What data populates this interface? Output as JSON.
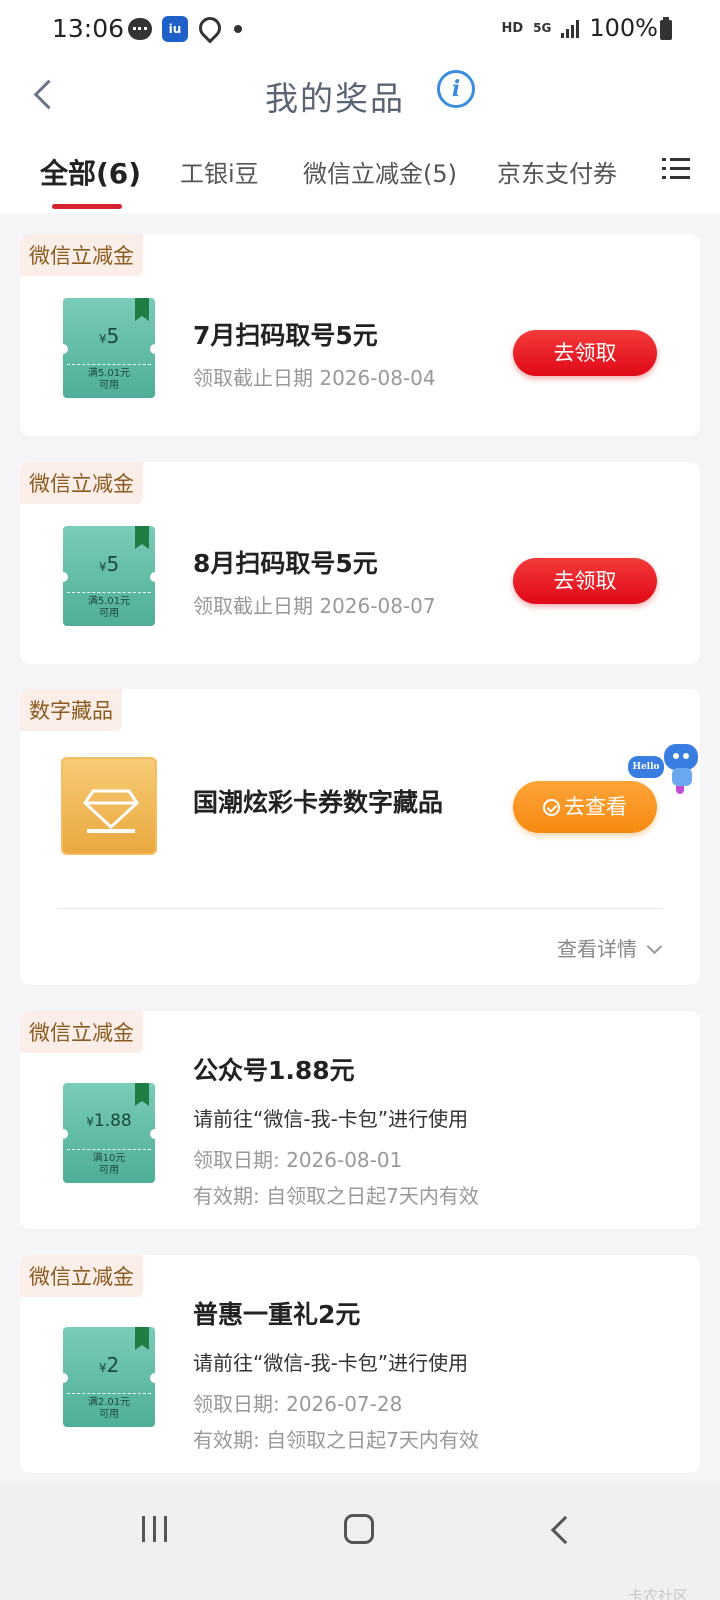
{
  "status_bar": {
    "time": "13:06",
    "app_icon_text": "iu",
    "hd": "HD",
    "network": "5G",
    "battery": "100%"
  },
  "header": {
    "title": "我的奖品",
    "info_icon": "i"
  },
  "tabs": [
    {
      "label": "全部(6)",
      "active": true
    },
    {
      "label": "工银i豆",
      "active": false
    },
    {
      "label": "微信立减金(5)",
      "active": false
    },
    {
      "label": "京东支付券",
      "active": false
    }
  ],
  "cards": [
    {
      "tag": "微信立减金",
      "coupon": {
        "symbol": "¥",
        "amount": "5",
        "cond_line1": "满5.01元",
        "cond_line2": "可用"
      },
      "title": "7月扫码取号5元",
      "subtitle": "领取截止日期 2026-08-04",
      "button": "去领取"
    },
    {
      "tag": "微信立减金",
      "coupon": {
        "symbol": "¥",
        "amount": "5",
        "cond_line1": "满5.01元",
        "cond_line2": "可用"
      },
      "title": "8月扫码取号5元",
      "subtitle": "领取截止日期 2026-08-07",
      "button": "去领取"
    },
    {
      "tag": "数字藏品",
      "title": "国潮炫彩卡券数字藏品",
      "button": "去查看",
      "details_link": "查看详情"
    },
    {
      "tag": "微信立减金",
      "coupon": {
        "symbol": "¥",
        "amount": "1.88",
        "cond_line1": "满10元",
        "cond_line2": "可用"
      },
      "title": "公众号1.88元",
      "desc": "请前往“微信-我-卡包”进行使用",
      "date": "领取日期: 2026-08-01",
      "validity": "有效期: 自领取之日起7天内有效"
    },
    {
      "tag": "微信立减金",
      "coupon": {
        "symbol": "¥",
        "amount": "2",
        "cond_line1": "满2.01元",
        "cond_line2": "可用"
      },
      "title": "普惠一重礼2元",
      "desc": "请前往“微信-我-卡包”进行使用",
      "date": "领取日期: 2026-07-28",
      "validity": "有效期: 自领取之日起7天内有效"
    }
  ],
  "assistant": {
    "bubble": "Hello"
  },
  "watermark": "卡农社区",
  "colors": {
    "accent_red": "#e00818",
    "accent_orange": "#f58a10",
    "coupon_green": "#4fae97",
    "tag_bg": "#fbeee8",
    "tag_text": "#8a5a1f",
    "info_blue": "#3a8dde"
  }
}
